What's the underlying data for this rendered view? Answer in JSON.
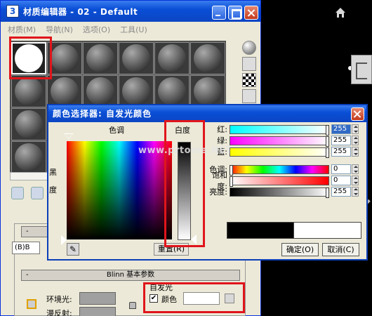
{
  "editor": {
    "title": "材质编辑器 - 02 - Default",
    "app_icon": "3",
    "menu": [
      "材质(M)",
      "导航(N)",
      "选项(O)",
      "工具(U)"
    ],
    "shader_rollout_title": "Blinn 基本参数",
    "shader_type": "(B)B",
    "ambient_label": "环境光:",
    "diffuse_label": "漫反射:",
    "self_illum_title": "自发光",
    "self_illum_color_label": "颜色",
    "self_illum_checked": "✔",
    "rollout_minus": "-"
  },
  "dialog": {
    "title": "颜色选择器: 自发光颜色",
    "hue_label": "色调",
    "whiteness_label": "白度",
    "black_label": "黑",
    "degree_label": "度",
    "reset_label": "重置(R)",
    "ok_label": "确定(O)",
    "cancel_label": "取消(C)",
    "channels": [
      {
        "label": "红:",
        "value": "255"
      },
      {
        "label": "绿:",
        "value": "255"
      },
      {
        "label": "蓝:",
        "value": "255"
      },
      {
        "label": "色调:",
        "value": "0"
      },
      {
        "label": "饱和度:",
        "value": "0"
      },
      {
        "label": "亮度:",
        "value": "255"
      }
    ],
    "old_color": "#000000",
    "new_color": "#ffffff"
  },
  "watermark": "www.prtome.NET",
  "colors": {
    "highlight": "#e0151b",
    "title_bar": "#0a4fd6"
  }
}
